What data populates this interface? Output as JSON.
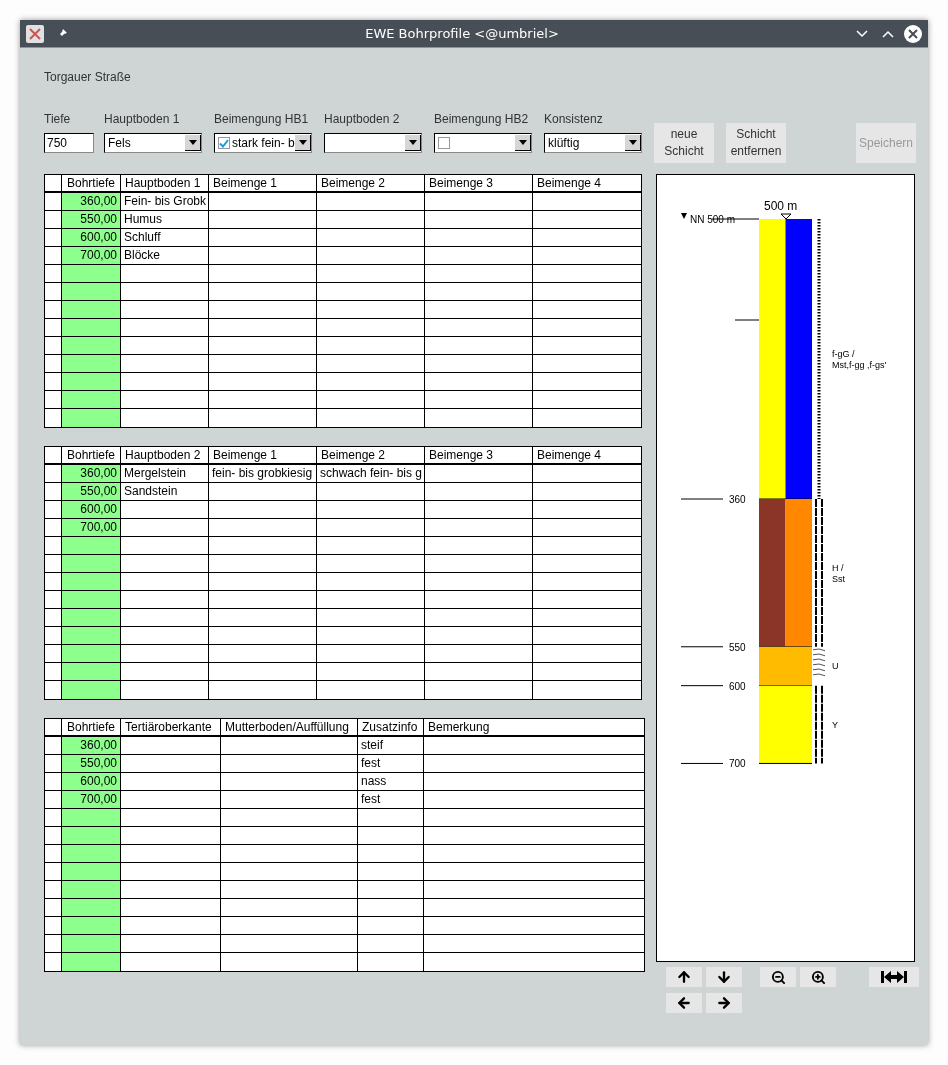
{
  "window": {
    "title": "EWE Bohrprofile <@umbriel>"
  },
  "location": "Torgauer Straße",
  "form": {
    "fields": [
      {
        "kind": "text",
        "label": "Tiefe",
        "value": "750"
      },
      {
        "kind": "select",
        "label": "Hauptboden 1",
        "value": "Fels"
      },
      {
        "kind": "check-select",
        "label": "Beimengung HB1",
        "checked": true,
        "value": "stark fein- b"
      },
      {
        "kind": "select",
        "label": "Hauptboden 2"
      },
      {
        "kind": "check-select",
        "label": "Beimengung HB2",
        "checked": false
      },
      {
        "kind": "select",
        "label": "Konsistenz",
        "value": "klüftig"
      }
    ],
    "buttons": [
      {
        "lines": [
          "neue",
          "Schicht"
        ],
        "disabled": false
      },
      {
        "lines": [
          "Schicht",
          "entfernen"
        ],
        "disabled": false
      },
      {
        "lines": [
          "Speichern"
        ],
        "disabled": true
      }
    ]
  },
  "tables": [
    {
      "columns": [
        "Bohrtiefe",
        "Hauptboden 1",
        "Beimenge 1",
        "Beimenge 2",
        "Beimenge 3",
        "Beimenge 4"
      ],
      "rows": [
        [
          "360,00",
          "Fein- bis Grobk",
          null,
          null,
          null,
          null
        ],
        [
          "550,00",
          "Humus",
          null,
          null,
          null,
          null
        ],
        [
          "600,00",
          "Schluff",
          null,
          null,
          null,
          null
        ],
        [
          "700,00",
          "Blöcke",
          null,
          null,
          null,
          null
        ]
      ]
    },
    {
      "columns": [
        "Bohrtiefe",
        "Hauptboden 2",
        "Beimenge 1",
        "Beimenge 2",
        "Beimenge 3",
        "Beimenge 4"
      ],
      "rows": [
        [
          "360,00",
          "Mergelstein",
          "fein- bis grobkiesig",
          "schwach fein- bis g",
          null,
          null
        ],
        [
          "550,00",
          "Sandstein",
          null,
          null,
          null,
          null
        ],
        [
          "600,00",
          null,
          null,
          null,
          null,
          null
        ],
        [
          "700,00",
          null,
          null,
          null,
          null,
          null
        ]
      ]
    },
    {
      "columns": [
        "Bohrtiefe",
        "Tertiäroberkante",
        "Mutterboden/Auffüllung",
        "Zusatzinfo",
        "Bemerkung"
      ],
      "rows": [
        [
          "360,00",
          null,
          null,
          "steif",
          null
        ],
        [
          "550,00",
          null,
          null,
          "fest",
          null
        ],
        [
          "600,00",
          null,
          null,
          "nass",
          null
        ],
        [
          "700,00",
          null,
          null,
          "fest",
          null
        ]
      ]
    }
  ],
  "profile": {
    "surface_label": "NN 500 m",
    "top_label": "500 m",
    "layers": [
      {
        "depth": "360",
        "parts": [
          {
            "color": "#ffff00"
          },
          {
            "color": "#0000ff"
          }
        ],
        "kind": "dotted",
        "label": [
          "f-gG /",
          "Mst,f-gg ,f-gs'"
        ]
      },
      {
        "depth": "550",
        "parts": [
          {
            "color": "#8b3528"
          },
          {
            "color": "#ff8800"
          }
        ],
        "kind": "double",
        "label": [
          "H /",
          "Sst"
        ]
      },
      {
        "depth": "600",
        "parts": [
          {
            "color": "#ffbb00"
          }
        ],
        "kind": "wavy",
        "label": [
          "U"
        ]
      },
      {
        "depth": "700",
        "parts": [
          {
            "color": "#ffff00"
          }
        ],
        "kind": "double",
        "label": [
          "Y"
        ]
      }
    ]
  }
}
